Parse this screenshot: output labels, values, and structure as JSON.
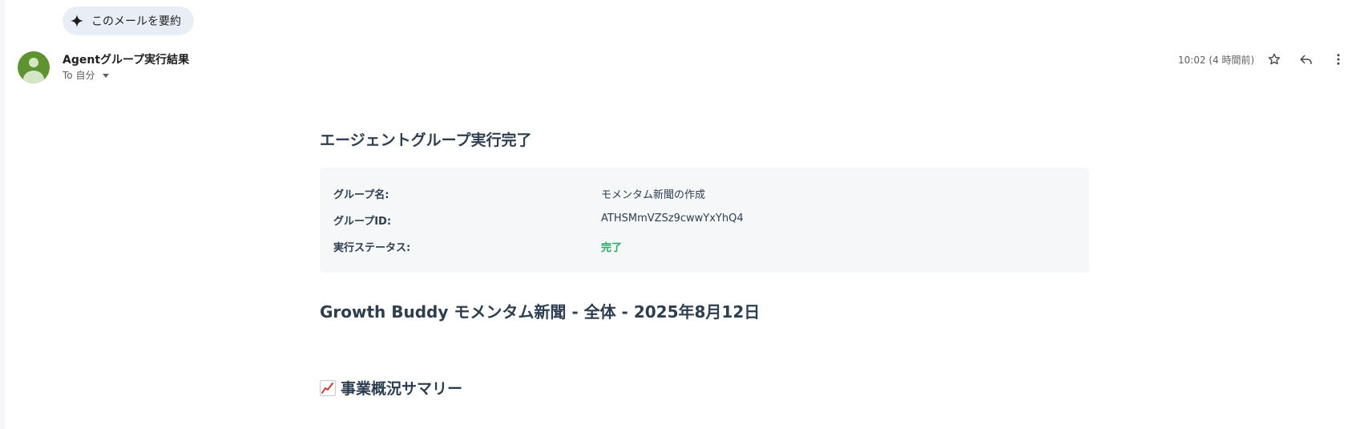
{
  "summarize_chip": {
    "label": "このメールを要約",
    "icon": "sparkle-icon"
  },
  "message": {
    "sender": "Agentグループ実行結果",
    "recipient": "To 自分",
    "timestamp": "10:02 (4 時間前)",
    "avatar_color": "#5d9431"
  },
  "actions": {
    "star_icon": "star-icon",
    "reply_icon": "reply-icon",
    "more_icon": "more-vert-icon"
  },
  "body": {
    "heading": "エージェントグループ実行完了",
    "info": {
      "group_name_label": "グループ名:",
      "group_name_value": "モメンタム新聞の作成",
      "group_id_label": "グループID:",
      "group_id_value": "ATHSMmVZSz9cwwYxYhQ4",
      "status_label": "実行ステータス:",
      "status_value": "完了",
      "status_color": "#27ae60"
    },
    "newsletter_title": "Growth Buddy モメンタム新聞 - 全体 - 2025年8月12日",
    "section_title": "事業概況サマリー",
    "section_icon": "chart-increasing-icon"
  }
}
